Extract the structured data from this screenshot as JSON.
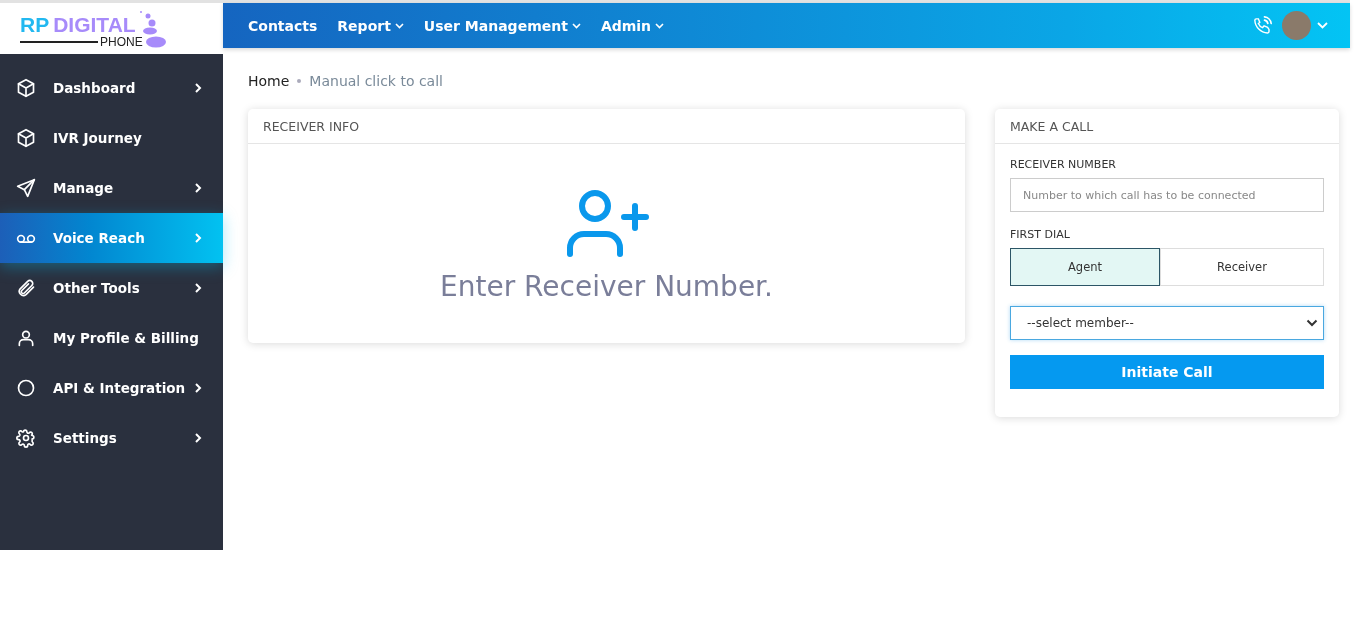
{
  "logo": {
    "primary": "RP",
    "secondary": "DIGITAL",
    "tagline": "PHONE"
  },
  "topnav": [
    {
      "label": "Contacts",
      "dropdown": false
    },
    {
      "label": "Report",
      "dropdown": true
    },
    {
      "label": "User Management",
      "dropdown": true
    },
    {
      "label": "Admin",
      "dropdown": true
    }
  ],
  "sidebar": {
    "items": [
      {
        "label": "Dashboard",
        "kind": "cube",
        "arrow": true,
        "selected": false
      },
      {
        "label": "IVR Journey",
        "kind": "cube",
        "arrow": false,
        "selected": false
      },
      {
        "label": "Manage",
        "kind": "send",
        "arrow": true,
        "selected": false
      },
      {
        "label": "Voice Reach",
        "kind": "voicemail",
        "arrow": true,
        "selected": true
      },
      {
        "label": "Other Tools",
        "kind": "paperclip",
        "arrow": true,
        "selected": false
      },
      {
        "label": "My Profile & Billing",
        "kind": "user",
        "arrow": false,
        "selected": false
      },
      {
        "label": "API & Integration",
        "kind": "circle",
        "arrow": true,
        "selected": false
      },
      {
        "label": "Settings",
        "kind": "gear",
        "arrow": true,
        "selected": false
      }
    ]
  },
  "breadcrumb": [
    "Home",
    "Manual click to call"
  ],
  "receiver_info": {
    "title": "RECEIVER INFO",
    "message": "Enter Receiver Number."
  },
  "make_call": {
    "title": "MAKE A CALL",
    "number_label": "RECEIVER NUMBER",
    "number_placeholder": "Number to which call has to be connected",
    "first_dial_label": "FIRST DIAL",
    "first_dial": [
      {
        "label": "Agent",
        "selected": true
      },
      {
        "label": "Receiver",
        "selected": false
      }
    ],
    "member_select": "--select member--",
    "button": "Initiate Call"
  }
}
